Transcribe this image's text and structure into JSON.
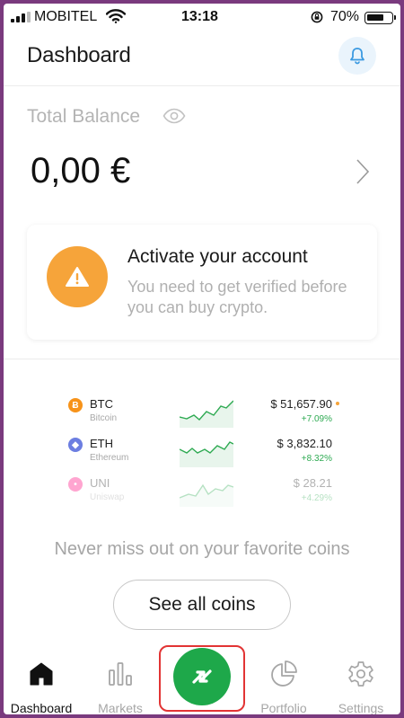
{
  "status_bar": {
    "carrier": "MOBITEL",
    "time": "13:18",
    "battery_percent": "70%",
    "battery_level": 0.7
  },
  "header": {
    "title": "Dashboard",
    "notification_icon": "bell-icon"
  },
  "balance": {
    "label": "Total Balance",
    "visibility_icon": "eye-icon",
    "value": "0,00 €",
    "details_icon": "chevron-right-icon"
  },
  "activation_card": {
    "icon": "warning-icon",
    "title": "Activate your account",
    "subtitle": "You need to get verified before you can buy crypto."
  },
  "coins": [
    {
      "symbol": "BTC",
      "name": "Bitcoin",
      "price": "$ 51,657.90",
      "change": "+7.09%",
      "icon_color": "#f7931a",
      "icon_glyph": "Ƀ"
    },
    {
      "symbol": "ETH",
      "name": "Ethereum",
      "price": "$ 3,832.10",
      "change": "+8.32%",
      "icon_color": "#6c7ee1",
      "icon_glyph": "◆"
    },
    {
      "symbol": "UNI",
      "name": "Uniswap",
      "price": "$ 28.21",
      "change": "+4.29%",
      "icon_color": "#ff007a",
      "icon_glyph": "•"
    }
  ],
  "tagline": "Never miss out on your favorite coins",
  "see_all_label": "See all coins",
  "bottom_nav": [
    {
      "label": "Dashboard",
      "icon": "home-icon",
      "active": true
    },
    {
      "label": "Markets",
      "icon": "bar-chart-icon",
      "active": false
    },
    {
      "label": "",
      "icon": "trade-arrows-icon",
      "active": false
    },
    {
      "label": "Portfolio",
      "icon": "pie-chart-icon",
      "active": false
    },
    {
      "label": "Settings",
      "icon": "gear-icon",
      "active": false
    }
  ],
  "colors": {
    "accent_green": "#1ea84a",
    "warning_orange": "#f6a43a",
    "highlight_red": "#e23434",
    "positive_change": "#2eaa52"
  }
}
